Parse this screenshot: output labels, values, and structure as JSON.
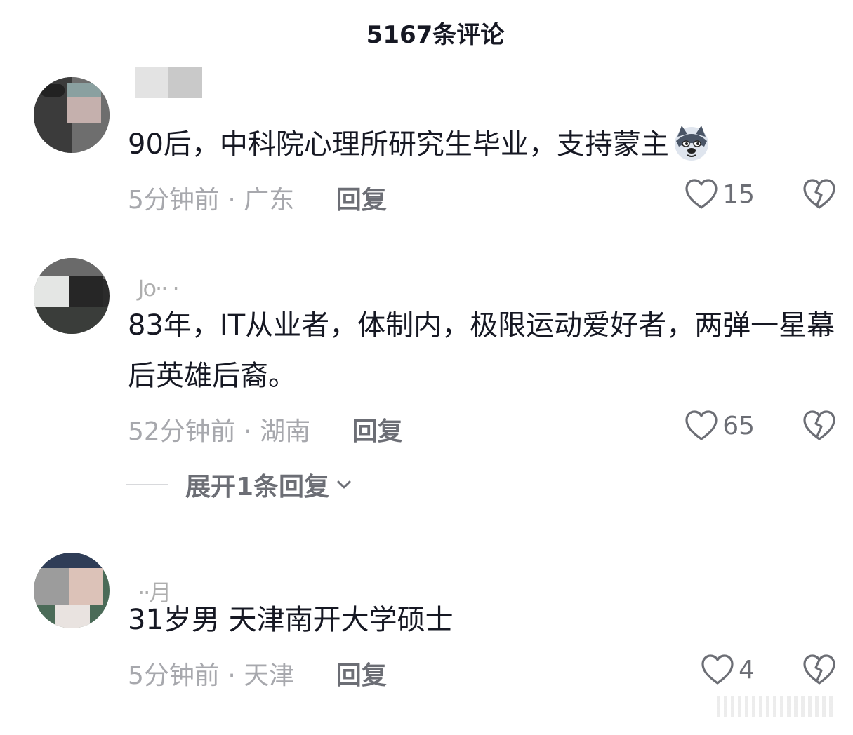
{
  "header": {
    "title": "5167条评论"
  },
  "comments": [
    {
      "username": "",
      "text": "90后，中科院心理所研究生毕业，支持蒙主",
      "emoji": "wolf-emoji-icon",
      "time_location": "5分钟前 · 广东",
      "reply_label": "回复",
      "likes": "15"
    },
    {
      "username": "",
      "text": "83年，IT从业者，体制内，极限运动爱好者，两弹一星幕后英雄后裔。",
      "time_location": "52分钟前 · 湖南",
      "reply_label": "回复",
      "likes": "65",
      "expand_label": "展开1条回复"
    },
    {
      "username": "",
      "text": "31岁男 天津南开大学硕士",
      "time_location": "5分钟前 · 天津",
      "reply_label": "回复",
      "likes": "4"
    }
  ],
  "colors": {
    "text": "#161823",
    "muted": "#a7a8ad",
    "action": "#6c6e75"
  }
}
